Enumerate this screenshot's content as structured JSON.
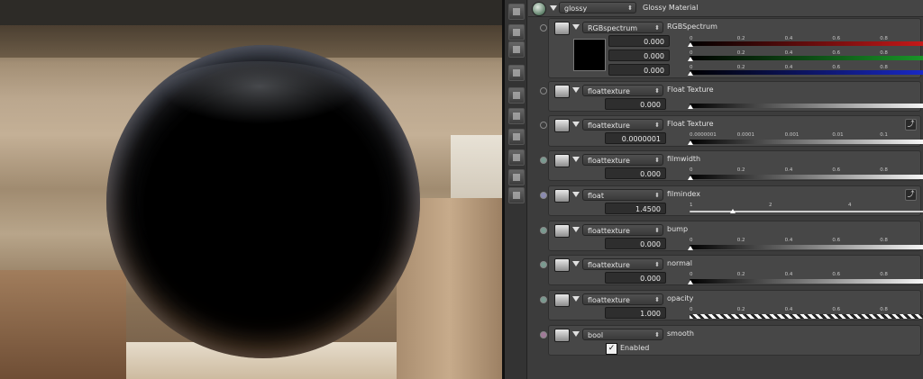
{
  "material": {
    "name": "glossy",
    "type_label": "Glossy Material"
  },
  "tools": [
    "render-region-icon",
    "layers-icon",
    "stack-icon",
    "image-icon",
    "brush-icon",
    "plane-icon",
    "cube-icon",
    "picture-icon",
    "uv-map-icon",
    "material-icon"
  ],
  "rows": [
    {
      "id": "kd",
      "combo": "RGBspectrum",
      "label": "RGBSpectrum",
      "values": [
        "0.000",
        "0.000",
        "0.000"
      ],
      "ticks": [
        "0",
        "0.2",
        "0.4",
        "0.6",
        "0.8",
        "1"
      ],
      "channel_colors": [
        "#cc1a1a",
        "#1a9a2a",
        "#1a2acc"
      ],
      "dot_color": "#3c3c3c"
    },
    {
      "id": "ks",
      "combo": "floattexture",
      "label": "Float Texture",
      "value": "0.000",
      "ticks": [],
      "dot_color": "#3c3c3c"
    },
    {
      "id": "rough",
      "combo": "floattexture",
      "label": "Float Texture",
      "value": "0.0000001",
      "ticks": [
        "0.0000001",
        "0.0001",
        "0.001",
        "0.01",
        "0.1",
        "1"
      ],
      "dot_color": "#3c3c3c",
      "curve_glyph": "⤴"
    },
    {
      "id": "filmwidth",
      "combo": "floattexture",
      "label": "filmwidth",
      "value": "0.000",
      "ticks": [
        "0",
        "0.2",
        "0.4",
        "0.6",
        "0.8",
        "1"
      ],
      "dot_color": "#7a9a90"
    },
    {
      "id": "filmindex",
      "combo": "float",
      "label": "filmindex",
      "value": "1.4500",
      "ticks": [
        "1",
        "2",
        "4",
        "8"
      ],
      "dot_color": "#8a8ab0",
      "marker_value": 1.45,
      "curve_glyph": "⤴"
    },
    {
      "id": "bump",
      "combo": "floattexture",
      "label": "bump",
      "value": "0.000",
      "ticks": [
        "0",
        "0.2",
        "0.4",
        "0.6",
        "0.8",
        "1"
      ],
      "dot_color": "#7a9a90"
    },
    {
      "id": "normal",
      "combo": "floattexture",
      "label": "normal",
      "value": "0.000",
      "ticks": [
        "0",
        "0.2",
        "0.4",
        "0.6",
        "0.8",
        "1"
      ],
      "dot_color": "#7a9a90"
    },
    {
      "id": "opacity",
      "combo": "floattexture",
      "label": "opacity",
      "value": "1.000",
      "ticks": [
        "0",
        "0.2",
        "0.4",
        "0.6",
        "0.8",
        "1"
      ],
      "dot_color": "#7a9a90"
    },
    {
      "id": "smooth",
      "combo": "bool",
      "label": "smooth",
      "checkbox_label": "Enabled",
      "checked": true,
      "dot_color": "#a07a98"
    }
  ]
}
